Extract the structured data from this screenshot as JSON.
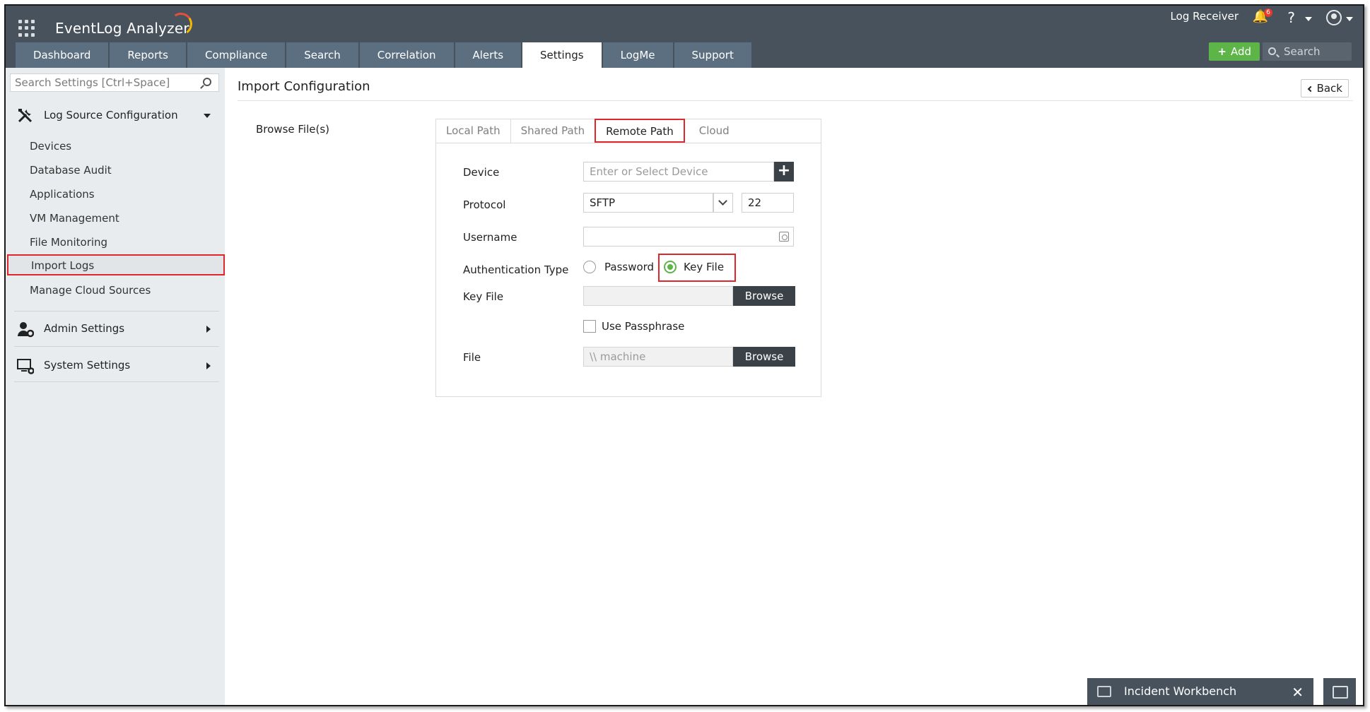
{
  "app": {
    "title": "EventLog Analyzer"
  },
  "header": {
    "log_receiver": "Log Receiver",
    "notification_count": "6",
    "help": "?",
    "add_label": "Add",
    "search_placeholder": "Search"
  },
  "tabs": [
    {
      "label": "Dashboard"
    },
    {
      "label": "Reports"
    },
    {
      "label": "Compliance"
    },
    {
      "label": "Search"
    },
    {
      "label": "Correlation"
    },
    {
      "label": "Alerts"
    },
    {
      "label": "Settings",
      "active": true
    },
    {
      "label": "LogMe"
    },
    {
      "label": "Support"
    }
  ],
  "sidebar": {
    "search_placeholder": "Search Settings [Ctrl+Space]",
    "groups": [
      {
        "label": "Log Source Configuration",
        "expanded": true
      },
      {
        "label": "Admin Settings",
        "expanded": false
      },
      {
        "label": "System Settings",
        "expanded": false
      }
    ],
    "items": [
      {
        "label": "Devices"
      },
      {
        "label": "Database Audit"
      },
      {
        "label": "Applications"
      },
      {
        "label": "VM Management"
      },
      {
        "label": "File Monitoring"
      },
      {
        "label": "Import Logs",
        "selected": true
      },
      {
        "label": "Manage Cloud Sources"
      }
    ]
  },
  "main": {
    "title": "Import Configuration",
    "back_label": "Back",
    "browse_label": "Browse File(s)",
    "subtabs": [
      {
        "label": "Local Path"
      },
      {
        "label": "Shared Path"
      },
      {
        "label": "Remote Path",
        "active": true
      },
      {
        "label": "Cloud"
      }
    ],
    "form": {
      "device_label": "Device",
      "device_placeholder": "Enter or Select Device",
      "protocol_label": "Protocol",
      "protocol_value": "SFTP",
      "port_value": "22",
      "username_label": "Username",
      "username_value": "",
      "auth_label": "Authentication Type",
      "auth_options": [
        {
          "label": "Password",
          "checked": false
        },
        {
          "label": "Key File",
          "checked": true
        }
      ],
      "keyfile_label": "Key File",
      "browse_label": "Browse",
      "passphrase_label": "Use Passphrase",
      "file_label": "File",
      "file_placeholder": "\\\\ machine"
    }
  },
  "footer": {
    "workbench_label": "Incident Workbench",
    "close": "✕"
  },
  "colors": {
    "header_bg": "#48525c",
    "tab_bg": "#5c6f80",
    "accent_green": "#5db548",
    "highlight_red": "#e0252b"
  }
}
